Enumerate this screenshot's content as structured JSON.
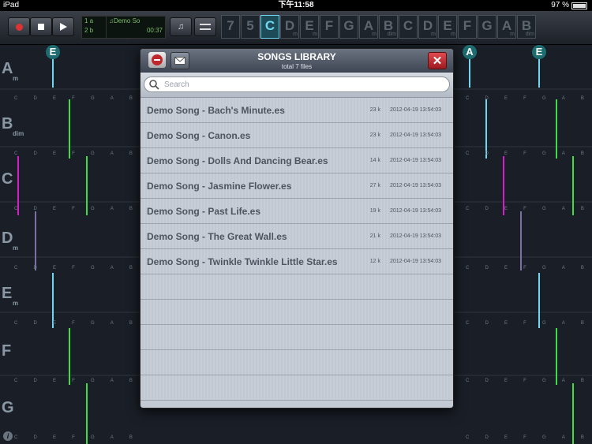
{
  "status": {
    "carrier": "iPad",
    "time": "下午11:58",
    "battery": "97 %"
  },
  "toolbar": {
    "lcd_line1": "♫Demo So",
    "lcd_line2": "00:37",
    "track_a": "1 a",
    "track_b": "2 b",
    "keys": [
      {
        "label": "7",
        "sub": ""
      },
      {
        "label": "5",
        "sub": ""
      },
      {
        "label": "C",
        "sub": ""
      },
      {
        "label": "D",
        "sub": "m"
      },
      {
        "label": "E",
        "sub": "m"
      },
      {
        "label": "F",
        "sub": ""
      },
      {
        "label": "G",
        "sub": ""
      },
      {
        "label": "A",
        "sub": "m"
      },
      {
        "label": "B",
        "sub": "dim"
      },
      {
        "label": "C",
        "sub": ""
      },
      {
        "label": "D",
        "sub": "m"
      },
      {
        "label": "E",
        "sub": "m"
      },
      {
        "label": "F",
        "sub": ""
      },
      {
        "label": "G",
        "sub": ""
      },
      {
        "label": "A",
        "sub": "m"
      },
      {
        "label": "B",
        "sub": "dim"
      }
    ]
  },
  "grid": {
    "rows": [
      {
        "label": "A",
        "sub": "m"
      },
      {
        "label": "B",
        "sub": "dim"
      },
      {
        "label": "C",
        "sub": ""
      },
      {
        "label": "D",
        "sub": "m"
      },
      {
        "label": "E",
        "sub": "m"
      },
      {
        "label": "F",
        "sub": ""
      },
      {
        "label": "G",
        "sub": ""
      }
    ],
    "note_letters": [
      "C",
      "D",
      "E",
      "F",
      "G",
      "A",
      "B"
    ],
    "circles": [
      "E",
      "A",
      "E"
    ],
    "info_icon": "i"
  },
  "modal": {
    "title": "SONGS LIBRARY",
    "subtitle": "total 7 files",
    "search_placeholder": "Search",
    "files": [
      {
        "name": "Demo Song - Bach's Minute.es",
        "size": "23 k",
        "date": "2012-04-19 13:54:03"
      },
      {
        "name": "Demo Song - Canon.es",
        "size": "23 k",
        "date": "2012-04-19 13:54:03"
      },
      {
        "name": "Demo Song - Dolls And Dancing Bear.es",
        "size": "14 k",
        "date": "2012-04-19 13:54:03"
      },
      {
        "name": "Demo Song - Jasmine Flower.es",
        "size": "27 k",
        "date": "2012-04-19 13:54:03"
      },
      {
        "name": "Demo Song - Past Life.es",
        "size": "19 k",
        "date": "2012-04-19 13:54:03"
      },
      {
        "name": "Demo Song - The Great Wall.es",
        "size": "21 k",
        "date": "2012-04-19 13:54:03"
      },
      {
        "name": "Demo Song - Twinkle Twinkle Little Star.es",
        "size": "12 k",
        "date": "2012-04-19 13:54:03"
      }
    ],
    "empty_rows": 5
  },
  "colors": {
    "accent": "#6fd8f0",
    "green": "#3fdc4a",
    "magenta": "#d21fc8",
    "close": "#c0272d"
  }
}
